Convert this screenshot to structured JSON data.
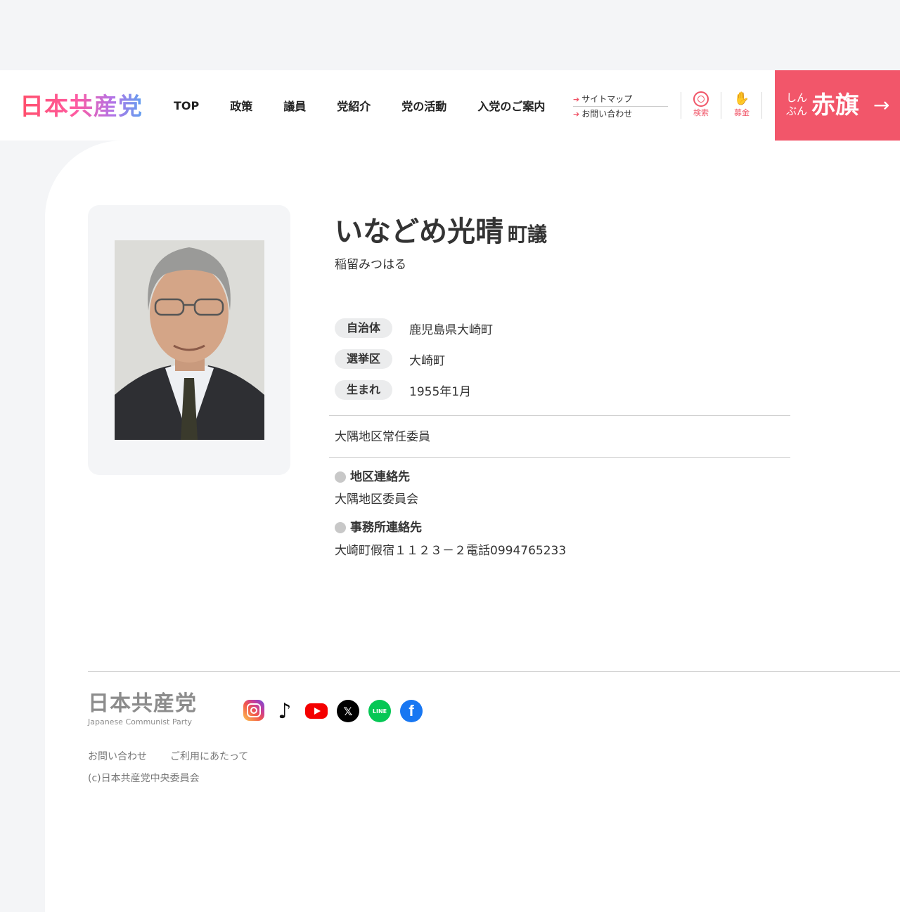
{
  "header": {
    "logo": "日本共産党",
    "nav": [
      "TOP",
      "政策",
      "議員",
      "党紹介",
      "党の活動",
      "入党のご案内"
    ],
    "sublinks": [
      "サイトマップ",
      "お問い合わせ"
    ],
    "search_label": "検索",
    "donate_label": "募金",
    "akahata_small": [
      "しん",
      "ぶん"
    ],
    "akahata_big": "赤旗"
  },
  "profile": {
    "name": "いなどめ光晴",
    "title": "町議",
    "kana": "稲留みつはる",
    "info": [
      {
        "label": "自治体",
        "value": "鹿児島県大崎町"
      },
      {
        "label": "選挙区",
        "value": "大崎町"
      },
      {
        "label": "生まれ",
        "value": "1955年1月"
      }
    ],
    "role": "大隅地区常任委員",
    "contacts": [
      {
        "heading": "地区連絡先",
        "value": "大隅地区委員会"
      },
      {
        "heading": "事務所連絡先",
        "value": "大崎町假宿１１２３－２電話0994765233"
      }
    ]
  },
  "footer": {
    "logo_jp": "日本共産党",
    "logo_en": "Japanese Communist Party",
    "social": [
      "instagram-icon",
      "tiktok-icon",
      "youtube-icon",
      "x-icon",
      "line-icon",
      "facebook-icon"
    ],
    "links": [
      "お問い合わせ",
      "ご利用にあたって"
    ],
    "copyright": "(c)日本共産党中央委員会"
  },
  "colors": {
    "accent": "#f2566a",
    "background": "#f4f5f7",
    "pill": "#ebeced"
  }
}
